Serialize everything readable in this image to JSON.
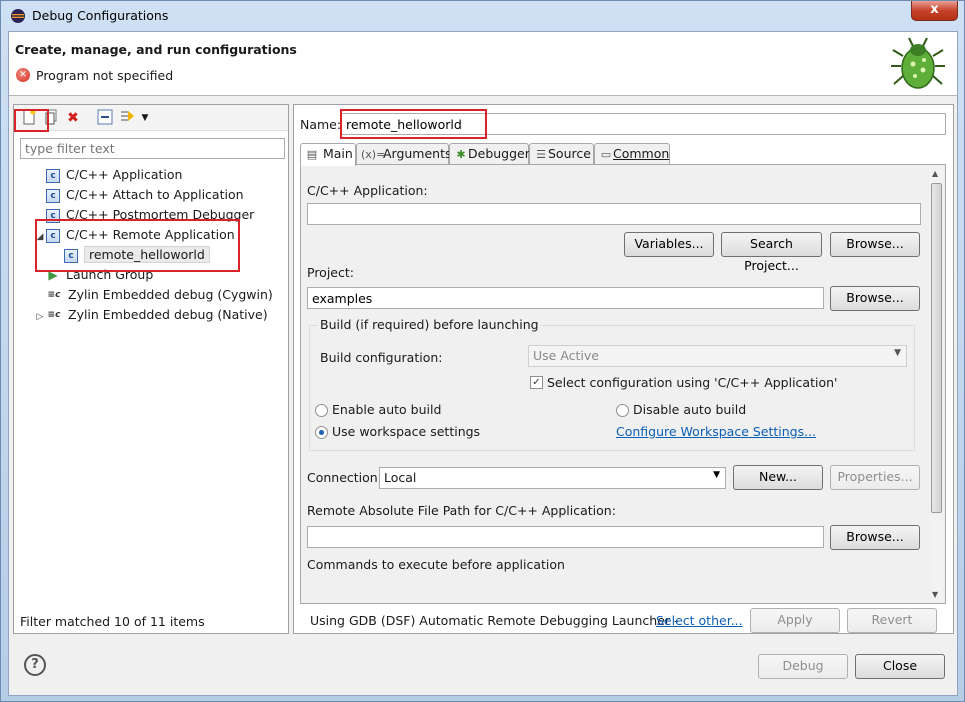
{
  "window": {
    "title": "Debug Configurations",
    "close_glyph": "x"
  },
  "banner": {
    "heading": "Create, manage, and run configurations",
    "message": "Program not specified"
  },
  "left": {
    "filter_placeholder": "type filter text",
    "tree": [
      {
        "label": "C/C++ Application",
        "icon": "c-icon"
      },
      {
        "label": "C/C++ Attach to Application",
        "icon": "c-icon"
      },
      {
        "label": "C/C++ Postmortem Debugger",
        "icon": "c-icon"
      },
      {
        "label": "C/C++ Remote Application",
        "icon": "c-icon",
        "expanded": true
      },
      {
        "label": "remote_helloworld",
        "icon": "c-icon",
        "selected": true
      },
      {
        "label": "Launch Group",
        "icon": "launch-group-icon"
      },
      {
        "label": "Zylin Embedded debug (Cygwin)",
        "icon": "zylin-icon"
      },
      {
        "label": "Zylin Embedded debug (Native)",
        "icon": "zylin-icon",
        "collapsed": true
      }
    ],
    "status": "Filter matched 10 of 11 items"
  },
  "right": {
    "name_label": "Name:",
    "name_value": "remote_helloworld",
    "tabs": [
      "Main",
      "Arguments",
      "Debugger",
      "Source",
      "Common"
    ],
    "main": {
      "app_label": "C/C++ Application:",
      "app_value": "",
      "variables_btn": "Variables...",
      "search_btn": "Search Project...",
      "browse_btn": "Browse...",
      "project_label": "Project:",
      "project_value": "examples",
      "build_group_title": "Build (if required) before launching",
      "build_config_label": "Build configuration:",
      "build_config_value": "Use Active",
      "select_config_label": "Select configuration using 'C/C++ Application'",
      "enable_auto_build": "Enable auto build",
      "disable_auto_build": "Disable auto build",
      "use_workspace": "Use workspace settings",
      "configure_link": "Configure Workspace Settings...",
      "connection_label": "Connection:",
      "connection_value": "Local",
      "new_btn": "New...",
      "properties_btn": "Properties...",
      "remote_path_label": "Remote Absolute File Path for C/C++ Application:",
      "remote_path_value": "",
      "commands_label": "Commands to execute before application"
    },
    "launcher_text": "Using GDB (DSF) Automatic Remote Debugging Launcher -",
    "select_other_link": "Select other...",
    "apply_btn": "Apply",
    "revert_btn": "Revert"
  },
  "footer": {
    "help_glyph": "?",
    "debug_btn": "Debug",
    "close_btn": "Close"
  }
}
